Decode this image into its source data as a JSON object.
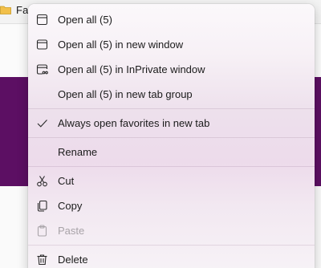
{
  "background": {
    "favorites_folder_label": "Fa"
  },
  "menu": {
    "items": [
      {
        "label": "Open all (5)",
        "icon": "tab-icon"
      },
      {
        "label": "Open all (5) in new window",
        "icon": "window-icon"
      },
      {
        "label": "Open all (5) in InPrivate window",
        "icon": "inprivate-window-icon"
      },
      {
        "label": "Open all (5) in new tab group",
        "icon": ""
      },
      {
        "label": "Always open favorites in new tab",
        "icon": "checkmark-icon",
        "checked": true
      },
      {
        "label": "Rename",
        "icon": ""
      },
      {
        "label": "Cut",
        "icon": "scissors-icon"
      },
      {
        "label": "Copy",
        "icon": "copy-icon"
      },
      {
        "label": "Paste",
        "icon": "paste-icon",
        "disabled": true
      },
      {
        "label": "Delete",
        "icon": "trash-icon"
      }
    ]
  },
  "colors": {
    "page_accent_purple": "#5c0f63",
    "menu_tint": "#eddbeb",
    "disabled_text": "#a8a3a8"
  }
}
